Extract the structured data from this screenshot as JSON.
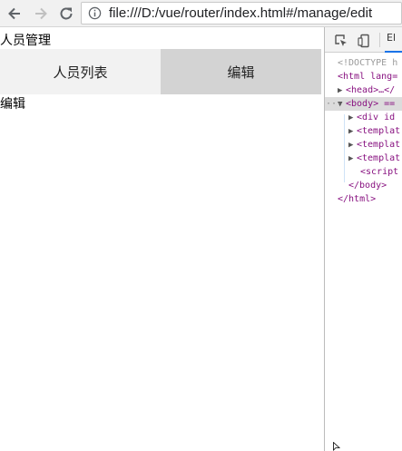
{
  "browser": {
    "url": "file:///D:/vue/router/index.html#/manage/edit"
  },
  "page": {
    "title": "人员管理",
    "tabs": [
      {
        "label": "人员列表",
        "active": false
      },
      {
        "label": "编辑",
        "active": true
      }
    ],
    "content": "编辑"
  },
  "devtools": {
    "tab_label": "El",
    "lines": [
      {
        "text": "<!DOCTYPE h"
      },
      {
        "text": "<html lang="
      },
      {
        "text": "<head>…</"
      },
      {
        "text": "<body> =="
      },
      {
        "text": "<div id"
      },
      {
        "text": "<templat"
      },
      {
        "text": "<templat"
      },
      {
        "text": "<templat"
      },
      {
        "text": "<script"
      },
      {
        "text": "</body>"
      },
      {
        "text": "</html>"
      }
    ]
  }
}
